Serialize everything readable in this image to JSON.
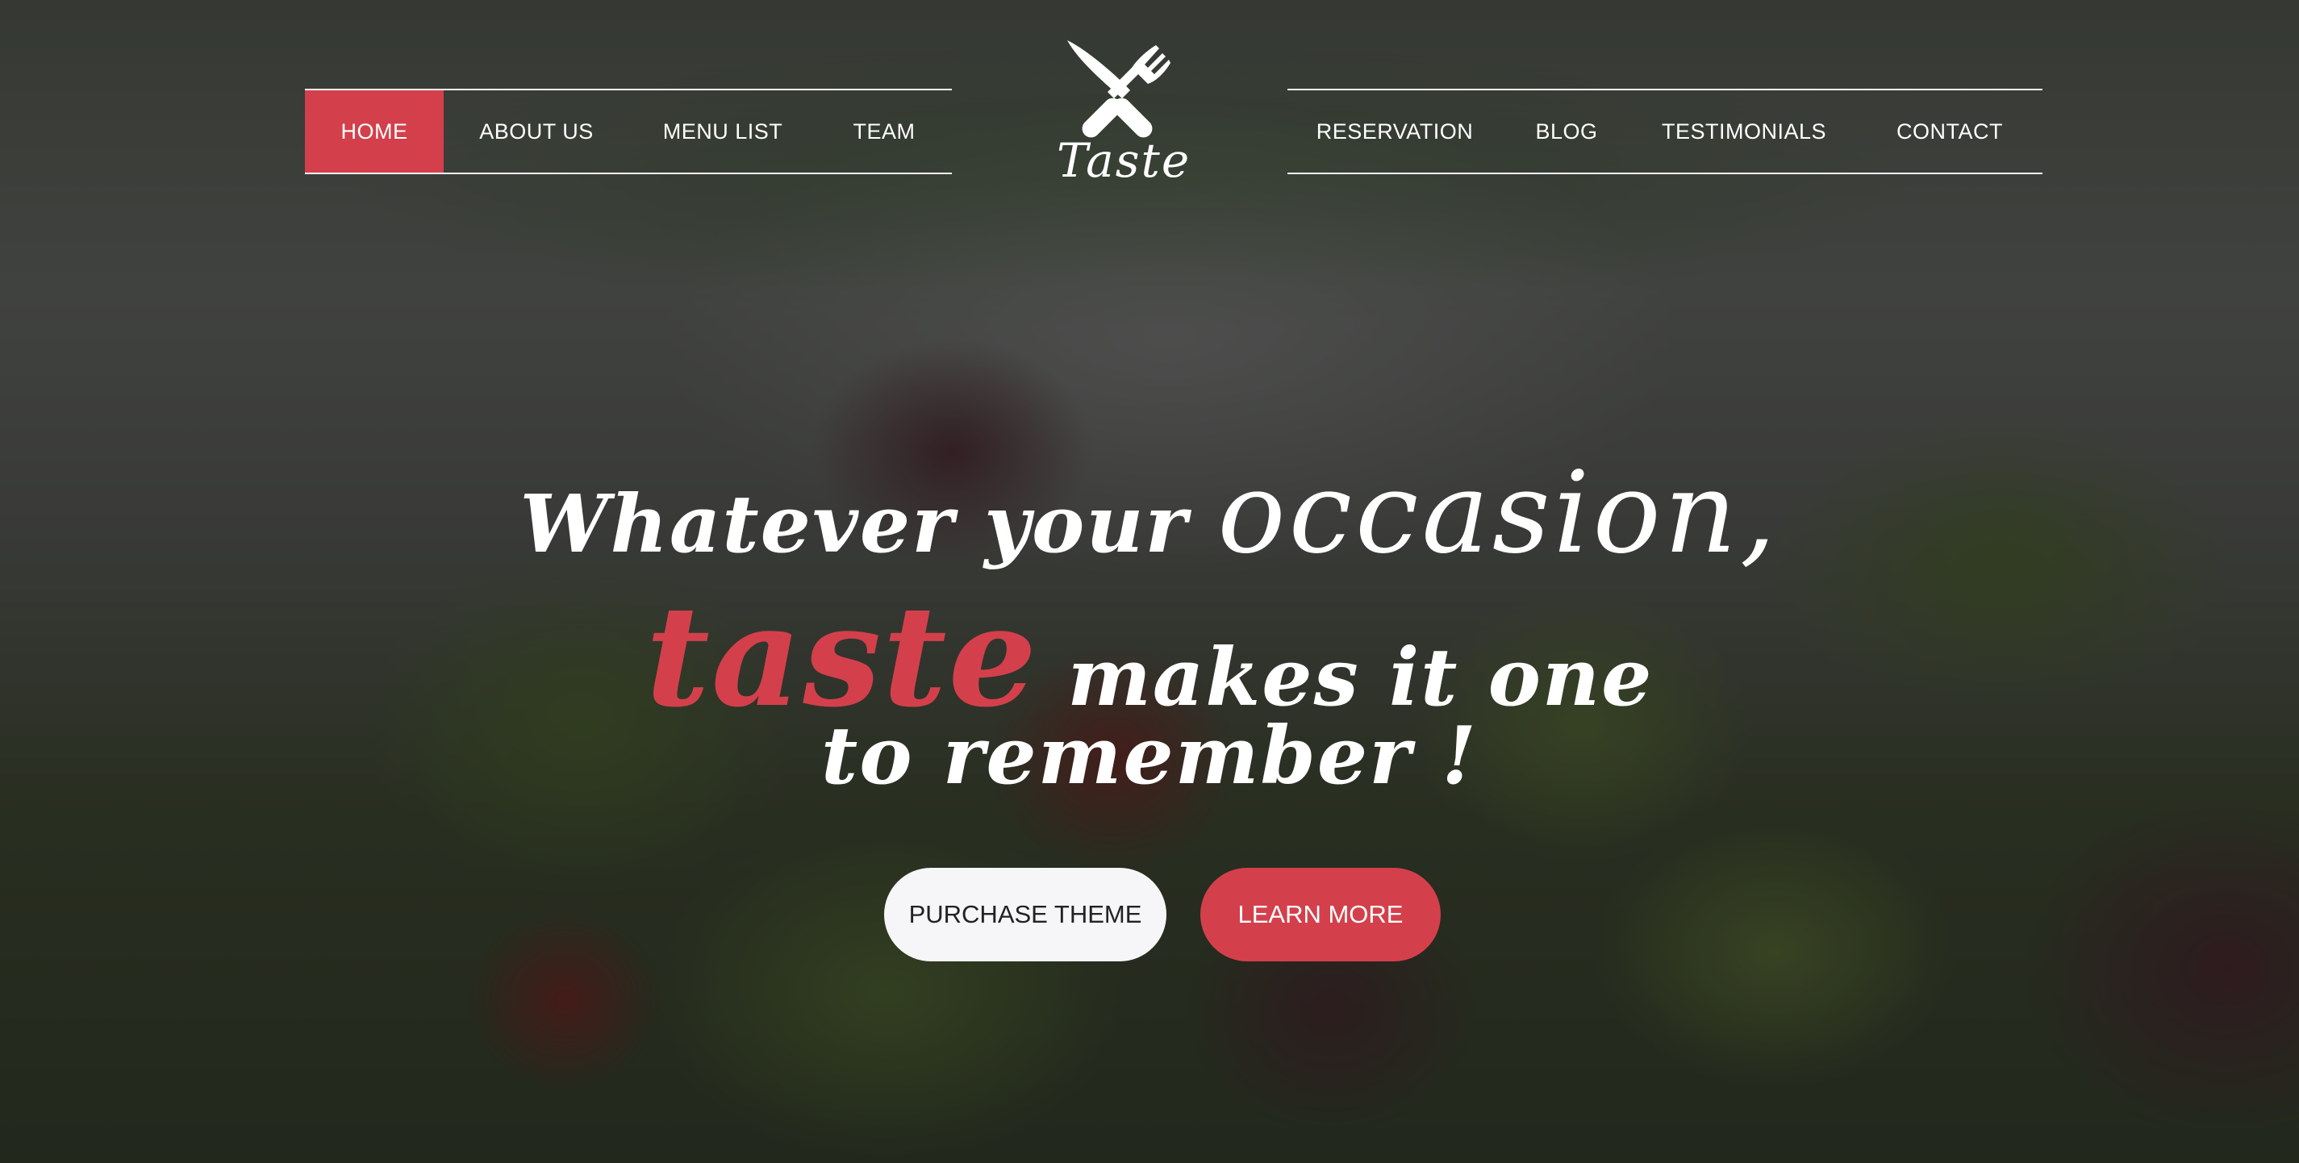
{
  "colors": {
    "accent": "#d3404b",
    "text": "#ffffff",
    "secondary_button_bg": "#f6f6f8"
  },
  "nav_left": [
    {
      "label": "HOME",
      "active": true
    },
    {
      "label": "ABOUT US",
      "active": false
    },
    {
      "label": "MENU LIST",
      "active": false
    },
    {
      "label": "TEAM",
      "active": false
    }
  ],
  "nav_right": [
    {
      "label": "RESERVATION",
      "active": false
    },
    {
      "label": "BLOG",
      "active": false
    },
    {
      "label": "TESTIMONIALS",
      "active": false
    },
    {
      "label": "CONTACT",
      "active": false
    }
  ],
  "logo": {
    "icon": "fork-knife-icon",
    "text": "Taste"
  },
  "hero": {
    "line1_part1": "Whatever your ",
    "line1_part2": "occasion,",
    "line2_part1": "taste",
    "line2_part2": " makes it one",
    "line3": "to remember !"
  },
  "buttons": {
    "purchase": "PURCHASE THEME",
    "learn_more": "LEARN MORE"
  }
}
